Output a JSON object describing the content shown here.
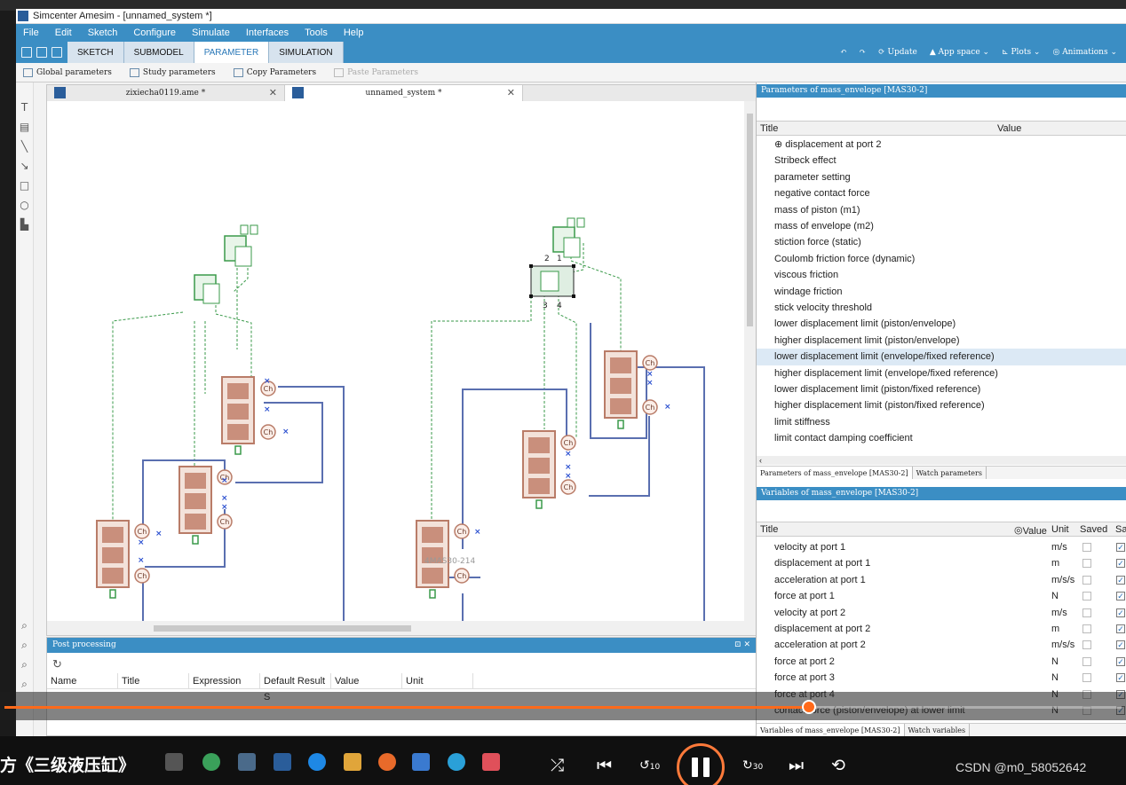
{
  "window": {
    "title": "Simcenter Amesim - [unnamed_system *]"
  },
  "menu": [
    "File",
    "Edit",
    "Sketch",
    "Configure",
    "Simulate",
    "Interfaces",
    "Tools",
    "Help"
  ],
  "modes": [
    "SKETCH",
    "SUBMODEL",
    "PARAMETER",
    "SIMULATION"
  ],
  "active_mode": "PARAMETER",
  "toolbar_right": {
    "update": "Update",
    "app_space": "App space",
    "plots": "Plots",
    "animations": "Animations"
  },
  "param_toolbar": [
    "Global parameters",
    "Study parameters",
    "Copy Parameters",
    "Paste Parameters"
  ],
  "doc_tabs": [
    "zixiecha0119.ame *",
    "unnamed_system *"
  ],
  "canvas": {
    "label_ch": "Ch",
    "selected_ports": [
      "2",
      "1",
      "3",
      "4"
    ],
    "hint_label": "4MAS30-214"
  },
  "post_processing": {
    "title": "Post processing",
    "columns": [
      "Name",
      "Title",
      "Expression",
      "Default Result S",
      "Value",
      "Unit"
    ]
  },
  "parameters_panel": {
    "header": "Parameters of mass_envelope [MAS30-2]",
    "col_title": "Title",
    "col_value": "Value",
    "rows": [
      "displacement at port 2",
      "Stribeck effect",
      "parameter setting",
      "negative contact force",
      "mass of piston (m1)",
      "mass of envelope (m2)",
      "stiction force (static)",
      "Coulomb friction force (dynamic)",
      "viscous friction",
      "windage friction",
      "stick velocity threshold",
      "lower displacement limit (piston/envelope)",
      "higher displacement limit (piston/envelope)",
      "lower displacement limit (envelope/fixed reference)",
      "higher displacement limit (envelope/fixed reference)",
      "lower displacement limit (piston/fixed reference)",
      "higher displacement limit (piston/fixed reference)",
      "limit stiffness",
      "limit contact damping coefficient"
    ],
    "selected_index": 13,
    "tabs": [
      "Parameters of mass_envelope [MAS30-2]",
      "Watch parameters"
    ]
  },
  "variables_panel": {
    "header": "Variables of mass_envelope [MAS30-2]",
    "col_title": "Title",
    "col_value": "Value",
    "col_unit": "Unit",
    "col_saved": "Saved",
    "col_extra": "Sa",
    "rows": [
      {
        "title": "velocity at port 1",
        "unit": "m/s"
      },
      {
        "title": "displacement at port 1",
        "unit": "m"
      },
      {
        "title": "acceleration at port 1",
        "unit": "m/s/s"
      },
      {
        "title": "force at port 1",
        "unit": "N"
      },
      {
        "title": "velocity at port 2",
        "unit": "m/s"
      },
      {
        "title": "displacement at port 2",
        "unit": "m"
      },
      {
        "title": "acceleration at port 2",
        "unit": "m/s/s"
      },
      {
        "title": "force at port 2",
        "unit": "N"
      },
      {
        "title": "force at port 3",
        "unit": "N"
      },
      {
        "title": "force at port 4",
        "unit": "N"
      },
      {
        "title": "contact force (piston/envelope) at lower limit",
        "unit": "N"
      }
    ],
    "tabs": [
      "Variables of mass_envelope [MAS30-2]",
      "Watch variables"
    ]
  },
  "video": {
    "title": "方《三级液压缸》",
    "progress_fraction": 0.72,
    "skip_back": "10",
    "skip_fwd": "30",
    "watermark": "CSDN @m0_58052642"
  },
  "colors": {
    "accent": "#3b8ec4",
    "progress": "#ff6a1a",
    "block": "#c98f7c",
    "green": "#3a9a4a",
    "wire": "#5a6fb0"
  }
}
